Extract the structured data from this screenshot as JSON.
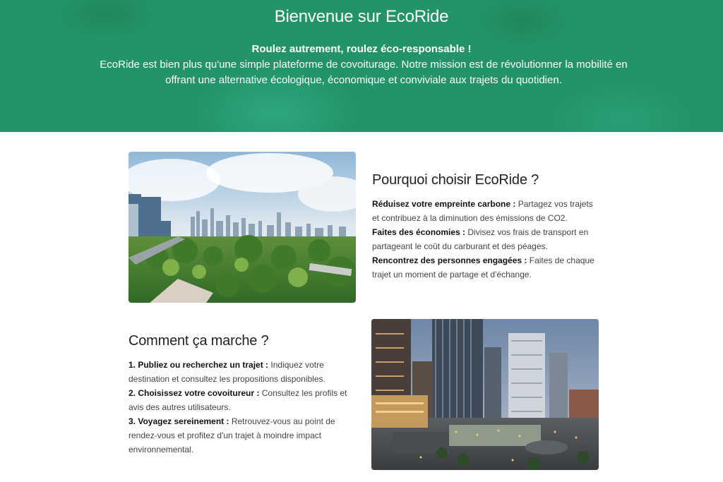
{
  "hero": {
    "title": "Bienvenue sur EcoRide",
    "tagline": "Roulez autrement, roulez éco-responsable !",
    "intro": "EcoRide est bien plus qu'une simple plateforme de covoiturage. Notre mission est de révolutionner la mobilité en offrant une alternative écologique, économique et conviviale aux trajets du quotidien."
  },
  "why": {
    "title": "Pourquoi choisir EcoRide ?",
    "items": [
      {
        "label": "Réduisez votre empreinte carbone :",
        "text": " Partagez vos trajets et contribuez à la diminution des émissions de CO2."
      },
      {
        "label": "Faites des économies :",
        "text": " Divisez vos frais de transport en partageant le coût du carburant et des péages."
      },
      {
        "label": "Rencontrez des personnes engagées :",
        "text": " Faites de chaque trajet un moment de partage et d'échange."
      }
    ]
  },
  "how": {
    "title": "Comment ça marche ?",
    "items": [
      {
        "label": "1. Publiez ou recherchez un trajet :",
        "text": " Indiquez votre destination et consultez les propositions disponibles."
      },
      {
        "label": "2. Choisissez votre covoitureur :",
        "text": " Consultez les profils et avis des autres utilisateurs."
      },
      {
        "label": "3. Voyagez sereinement :",
        "text": " Retrouvez-vous au point de rendez-vous et profitez d'un trajet à moindre impact environnemental."
      }
    ]
  },
  "colors": {
    "hero_green": "#23946a",
    "text_dark": "#222222"
  }
}
